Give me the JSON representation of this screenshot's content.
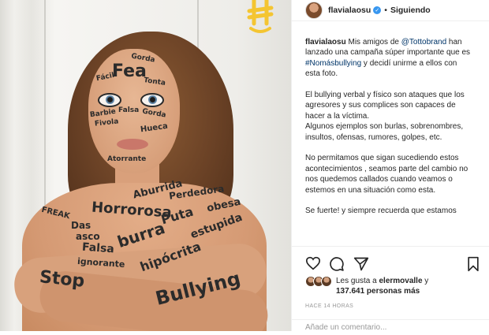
{
  "header": {
    "username": "flavialaosu",
    "separator": "•",
    "follow_status": "Siguiendo"
  },
  "caption": {
    "username": "flavialaosu",
    "p1_text_a": "Mis amigos de ",
    "p1_mention": "@Tottobrand",
    "p1_text_b": " han lanzado una campaña súper importante que es ",
    "p1_hashtag": "#Nomásbullying",
    "p1_text_c": " y decidí unirme a ellos con esta foto.",
    "p2": "El bullying verbal y físico son ataques que los agresores y sus complices son capaces de hacer a la víctima.",
    "p3": "Algunos ejemplos son burlas, sobrenombres, insultos, ofensas, rumores, golpes, etc.",
    "p4": "No permitamos que sigan sucediendo estos acontecimientos , seamos parte del cambio no nos quedemos callados cuando veamos o estemos en una situación como esta.",
    "p5": "Se fuerte! y siempre recuerda que estamos"
  },
  "likes": {
    "prefix": "Les gusta a ",
    "user": "elermovalle",
    "conjunction": " y",
    "count": "137.641",
    "suffix": " personas más"
  },
  "timestamp": "HACE 14 HORAS",
  "comment_placeholder": "Añade un comentario...",
  "photo_words": {
    "fea": "Fea",
    "gorda": "Gorda",
    "facil": "Fácil",
    "tonta": "Tonta",
    "falsa_face": "Falsa",
    "barbie": "Barbie",
    "fivola": "Fivola",
    "hueca": "Hueca",
    "gorda2": "Gorda",
    "atorrante": "Atorrante",
    "abu": "Abu",
    "aburrida": "Aburrida",
    "perdedora": "Perdedora",
    "obesa": "obesa",
    "freak": "FREAK",
    "das": "Das",
    "asco": "asco",
    "horrorosa": "Horrorosa",
    "puta": "Puta",
    "estupida": "estupida",
    "burra": "burra",
    "falsa": "Falsa",
    "ignorante": "ignorante",
    "hipocrita": "hipócrita",
    "stop": "Stop",
    "bullying": "Bullying"
  },
  "icons": [
    "heart-icon",
    "comment-icon",
    "share-icon",
    "bookmark-icon",
    "verified-icon"
  ],
  "colors": {
    "accent_link": "#003569",
    "verified": "#3897f0",
    "muted": "#999999",
    "logo_yellow": "#f4c531"
  }
}
